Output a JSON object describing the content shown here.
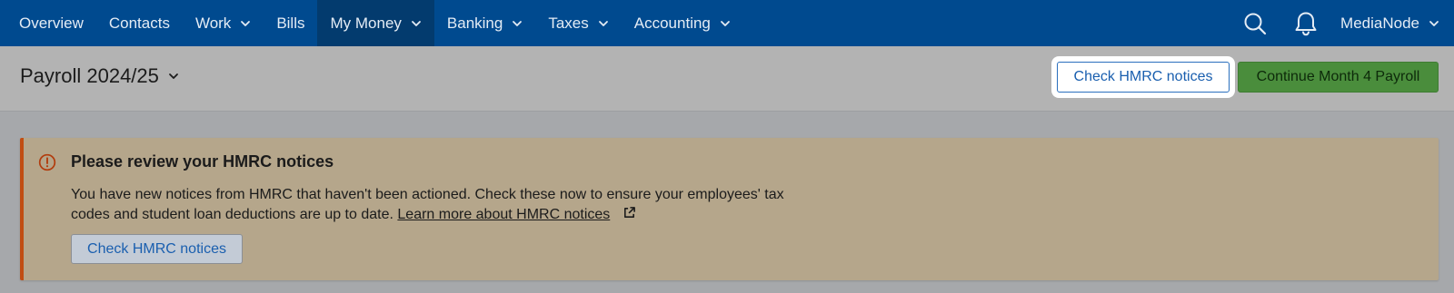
{
  "nav": {
    "items": [
      {
        "label": "Overview",
        "has_menu": false
      },
      {
        "label": "Contacts",
        "has_menu": false
      },
      {
        "label": "Work",
        "has_menu": true
      },
      {
        "label": "Bills",
        "has_menu": false
      },
      {
        "label": "My Money",
        "has_menu": true,
        "active": true
      },
      {
        "label": "Banking",
        "has_menu": true
      },
      {
        "label": "Taxes",
        "has_menu": true
      },
      {
        "label": "Accounting",
        "has_menu": true
      }
    ],
    "search_icon": "search-icon",
    "notification_icon": "bell-icon",
    "user": "MediaNode"
  },
  "header": {
    "title": "Payroll 2024/25",
    "check_hmrc_label": "Check HMRC notices",
    "continue_label": "Continue Month 4 Payroll"
  },
  "alert": {
    "title": "Please review your HMRC notices",
    "body_line1": "You have new notices from HMRC that haven't been actioned. Check these now to ensure your employees' tax",
    "body_line2": "codes and student loan deductions are up to date.",
    "link_text": "Learn more about HMRC notices",
    "button_label": "Check HMRC notices"
  },
  "colors": {
    "nav_bg": "#004a8f",
    "nav_active_bg": "#033b6e",
    "primary_button": "#4a8d3c",
    "alert_accent": "#c14d12",
    "link_blue": "#1a5faf"
  }
}
